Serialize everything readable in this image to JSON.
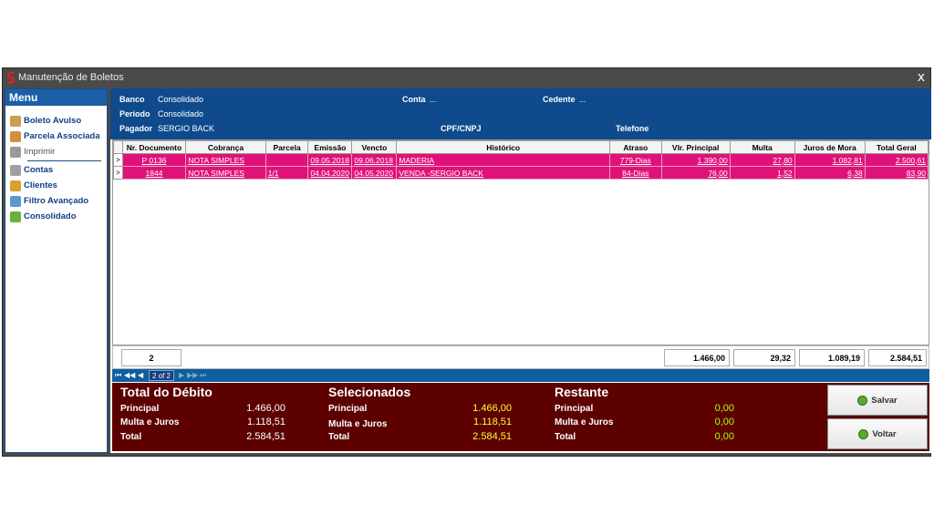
{
  "window": {
    "title": "Manutenção de Boletos",
    "close": "x"
  },
  "menu": {
    "header": "Menu",
    "items": [
      {
        "label": "Boleto Avulso",
        "icon": "receipt-icon",
        "color": "#c8a050"
      },
      {
        "label": "Parcela Associada",
        "icon": "receipt-stack-icon",
        "color": "#d09040"
      },
      {
        "label": "Imprimir",
        "icon": "printer-icon",
        "color": "#999999"
      },
      {
        "label": "Contas",
        "icon": "bank-icon",
        "color": "#a0a0a0"
      },
      {
        "label": "Clientes",
        "icon": "people-icon",
        "color": "#d8a030"
      },
      {
        "label": "Filtro Avançado",
        "icon": "filter-icon",
        "color": "#5a9ad0"
      },
      {
        "label": "Consolidado",
        "icon": "consolidated-icon",
        "color": "#6ab040"
      }
    ]
  },
  "info": {
    "banco_label": "Banco",
    "banco_value": "Consolidado",
    "conta_label": "Conta",
    "conta_value": "...",
    "cedente_label": "Cedente",
    "cedente_value": "...",
    "periodo_label": "Período",
    "periodo_value": "Consolidado",
    "pagador_label": "Pagador",
    "pagador_value": "SERGIO BACK",
    "cpf_label": "CPF/CNPJ",
    "telefone_label": "Telefone"
  },
  "table": {
    "columns": [
      "Nr. Documento",
      "Cobrança",
      "Parcela",
      "Emissão",
      "Vencto",
      "Histórico",
      "Atraso",
      "Vlr. Principal",
      "Multa",
      "Juros de Mora",
      "Total Geral"
    ],
    "rows": [
      {
        "indicator": ">",
        "cells": [
          "P 0136",
          "NOTA SIMPLES",
          "",
          "09.05.2018",
          "09.06.2018",
          "MADERIA",
          "779-Dias",
          "1.390,00",
          "27,80",
          "1.082,81",
          "2.500,61"
        ]
      },
      {
        "indicator": ">",
        "cells": [
          "1844",
          "NOTA SIMPLES",
          "1/1",
          "04.04.2020",
          "04.05.2020",
          "VENDA -SERGIO BACK",
          "84-Dias",
          "76,00",
          "1,52",
          "6,38",
          "83,90"
        ]
      }
    ],
    "row_color": "#e0127a"
  },
  "footer": {
    "count": "2",
    "principal": "1.466,00",
    "multa": "29,32",
    "juros": "1.089,19",
    "total": "2.584,51"
  },
  "nav": {
    "page": "2 of 2",
    "first": "⏮",
    "prev_page": "◀◀",
    "prev": "◀",
    "next": "▶",
    "next_page": "▶▶",
    "last": "⏭"
  },
  "summary": {
    "debito": {
      "title": "Total do Débito",
      "principal_label": "Principal",
      "principal": "1.466,00",
      "multa_label": "Multa e Juros",
      "multa": "1.118,51",
      "total_label": "Total",
      "total": "2.584,51"
    },
    "selecionados": {
      "title": "Selecionados",
      "principal_label": "Principal",
      "principal": "1.466,00",
      "multa_label": "Multa e Juros",
      "multa": "1.118,51",
      "total_label": "Total",
      "total": "2.584,51"
    },
    "restante": {
      "title": "Restante",
      "principal_label": "Principal",
      "principal": "0,00",
      "multa_label": "Multa e Juros",
      "multa": "0,00",
      "total_label": "Total",
      "total": "0,00"
    }
  },
  "buttons": {
    "salvar": "Salvar",
    "voltar": "Voltar"
  }
}
